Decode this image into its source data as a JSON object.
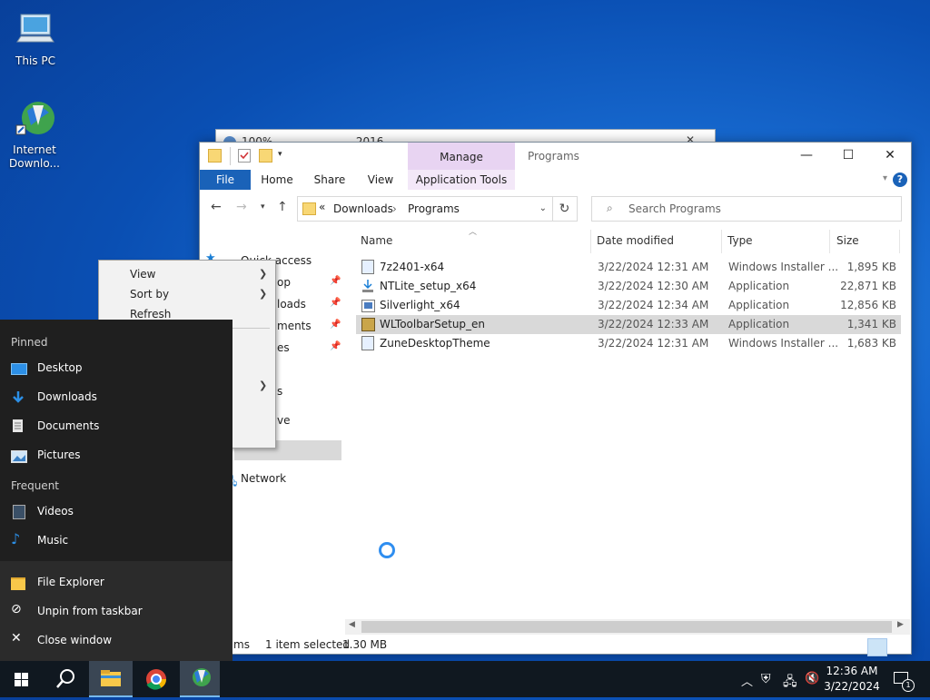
{
  "desktop": {
    "icons": [
      {
        "label": "This PC"
      },
      {
        "label": "Internet Downlo..."
      }
    ]
  },
  "back_window": {
    "title": "100% ...... .. ..... ...... 2016 ..... ... . ...."
  },
  "explorer": {
    "title": "Programs",
    "manage_label": "Manage",
    "tabs": {
      "file": "File",
      "home": "Home",
      "share": "Share",
      "view": "View",
      "app_tools": "Application Tools"
    },
    "address": {
      "prefix": "«",
      "crumbs": [
        "Downloads",
        "Programs"
      ]
    },
    "search_placeholder": "Search Programs",
    "nav": {
      "quick_access": "Quick access",
      "desktop_partial": "op",
      "downloads_partial": "loads",
      "documents_partial": "ments",
      "pictures_partial": "es",
      "item5_partial": "s",
      "item6_partial": "ve",
      "network": "Network"
    },
    "columns": {
      "name": "Name",
      "date": "Date modified",
      "type": "Type",
      "size": "Size"
    },
    "files": [
      {
        "name": "7z2401-x64",
        "date": "3/22/2024 12:31 AM",
        "type": "Windows Installer ...",
        "size": "1,895 KB"
      },
      {
        "name": "NTLite_setup_x64",
        "date": "3/22/2024 12:30 AM",
        "type": "Application",
        "size": "22,871 KB"
      },
      {
        "name": "Silverlight_x64",
        "date": "3/22/2024 12:34 AM",
        "type": "Application",
        "size": "12,856 KB"
      },
      {
        "name": "WLToolbarSetup_en",
        "date": "3/22/2024 12:33 AM",
        "type": "Application",
        "size": "1,341 KB"
      },
      {
        "name": "ZuneDesktopTheme",
        "date": "3/22/2024 12:31 AM",
        "type": "Windows Installer ...",
        "size": "1,683 KB"
      }
    ],
    "status": {
      "items_partial": "ms",
      "selected": "1 item selected",
      "size": "1.30 MB"
    }
  },
  "context_menu": {
    "view": "View",
    "sort_by": "Sort by",
    "refresh": "Refresh"
  },
  "jumplist": {
    "pinned_header": "Pinned",
    "pinned": [
      "Desktop",
      "Downloads",
      "Documents",
      "Pictures"
    ],
    "frequent_header": "Frequent",
    "frequent": [
      "Videos",
      "Music"
    ],
    "actions": [
      "File Explorer",
      "Unpin from taskbar",
      "Close window"
    ]
  },
  "taskbar": {
    "time": "12:36 AM",
    "date": "3/22/2024",
    "notification_count": "1"
  },
  "colors": {
    "accent": "#1a62b8",
    "manage_tab": "#e8d4f2",
    "jumplist_bg": "#1f1f1f",
    "taskbar_bg": "#101820"
  }
}
